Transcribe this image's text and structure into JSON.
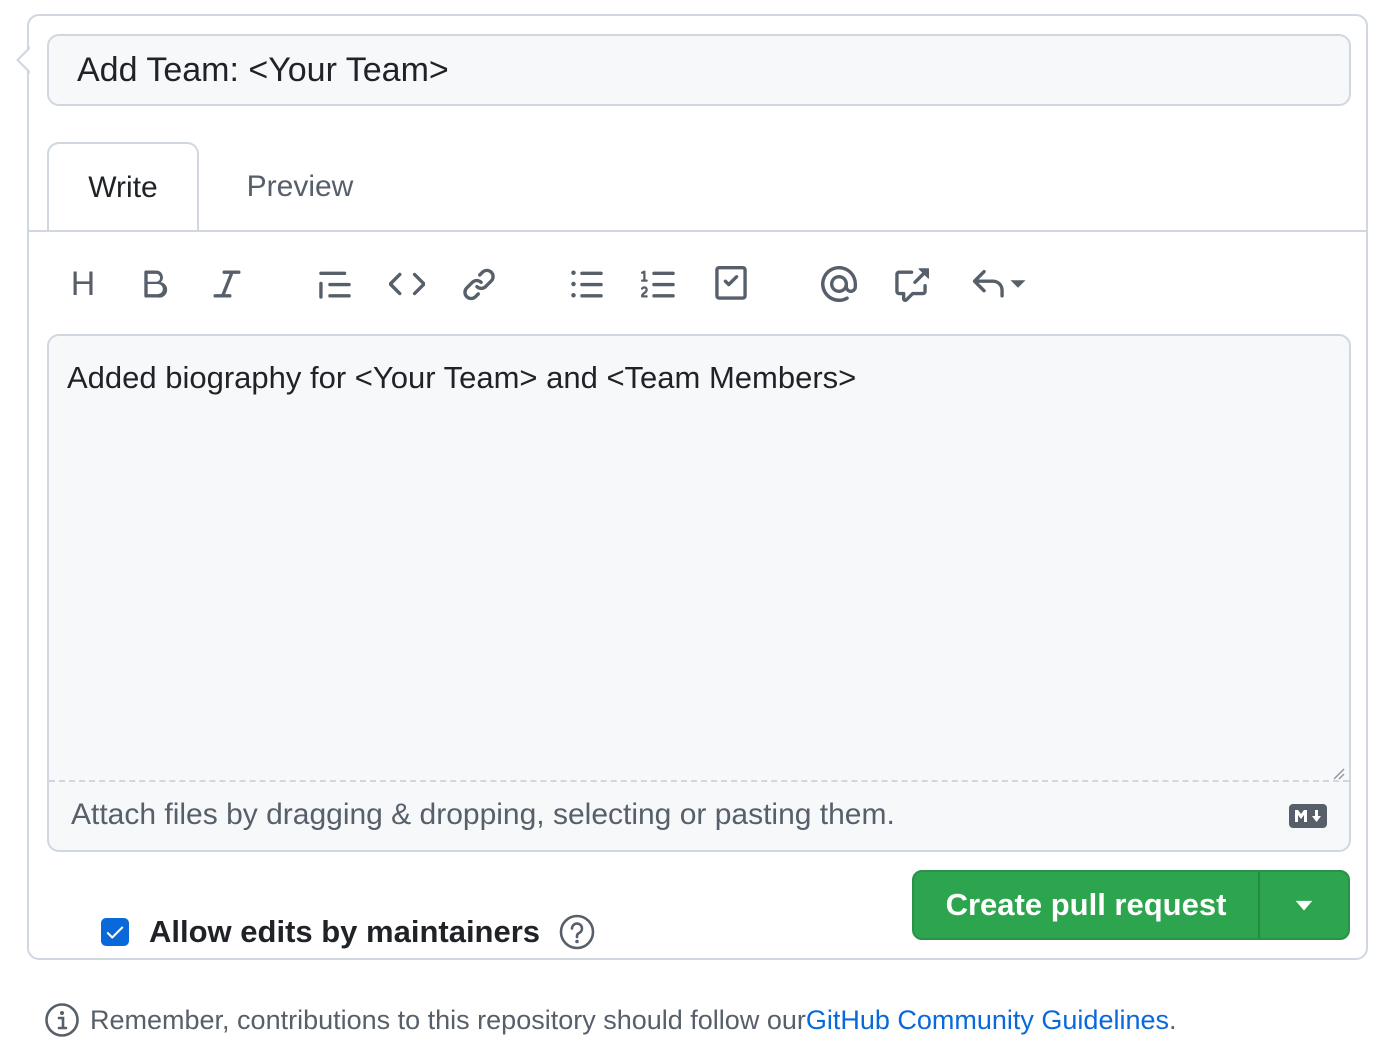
{
  "title_input": {
    "value": "Add Team: <Your Team>"
  },
  "tabs": [
    {
      "label": "Write",
      "active": true
    },
    {
      "label": "Preview",
      "active": false
    }
  ],
  "toolbar": {
    "heading_label": "H",
    "items": [
      "heading-icon",
      "bold-icon",
      "italic-icon",
      "quote-icon",
      "code-icon",
      "link-icon",
      "bulleted-list-icon",
      "numbered-list-icon",
      "task-list-icon",
      "mention-icon",
      "cross-reference-icon",
      "reply-icon"
    ]
  },
  "editor": {
    "body": "Added biography for <Your Team> and <Team Members>",
    "attach_hint": "Attach files by dragging & dropping, selecting or pasting them."
  },
  "options": {
    "allow_edits_label": "Allow edits by maintainers",
    "allow_edits_checked": true
  },
  "actions": {
    "create_label": "Create pull request"
  },
  "footer": {
    "note_prefix": "Remember, contributions to this repository should follow our ",
    "link_text": "GitHub Community Guidelines",
    "note_suffix": "."
  },
  "colors": {
    "primary_green": "#2da44e",
    "link_blue": "#0969da",
    "border": "#d0d7de",
    "muted": "#57606a"
  }
}
